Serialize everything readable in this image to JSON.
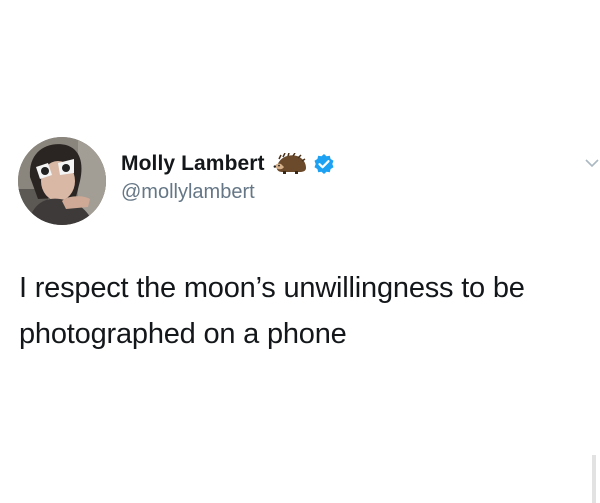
{
  "tweet": {
    "display_name": "Molly Lambert",
    "handle": "@mollylambert",
    "text": "I respect the moon’s unwillingness to be photographed on a phone",
    "name_emoji_icon": "hedgehog-icon",
    "verified_icon": "verified-badge-icon",
    "menu_icon": "chevron-down-icon"
  },
  "colors": {
    "text": "#14171a",
    "handle": "#657786",
    "verified": "#1da1f2",
    "background": "#ffffff"
  }
}
